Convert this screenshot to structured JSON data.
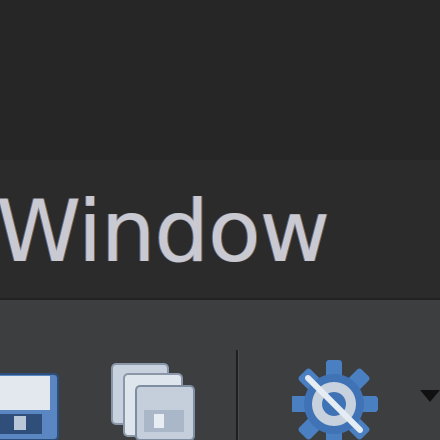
{
  "menu_bar": {
    "items": [
      {
        "label": "Window"
      }
    ]
  },
  "toolbar": {
    "buttons": [
      {
        "name": "save",
        "icon": "save-icon"
      },
      {
        "name": "save-all",
        "icon": "save-all-icon"
      },
      {
        "name": "settings",
        "icon": "gear-icon"
      },
      {
        "name": "dropdown",
        "icon": "chevron-down-icon"
      }
    ]
  },
  "colors": {
    "title_bar": "#262626",
    "menu_bar": "#2b2b2b",
    "menu_text": "#c9c9d2",
    "toolbar": "#3c3e40",
    "icon_blue": "#4a7fc1",
    "icon_light": "#c8d2de"
  }
}
